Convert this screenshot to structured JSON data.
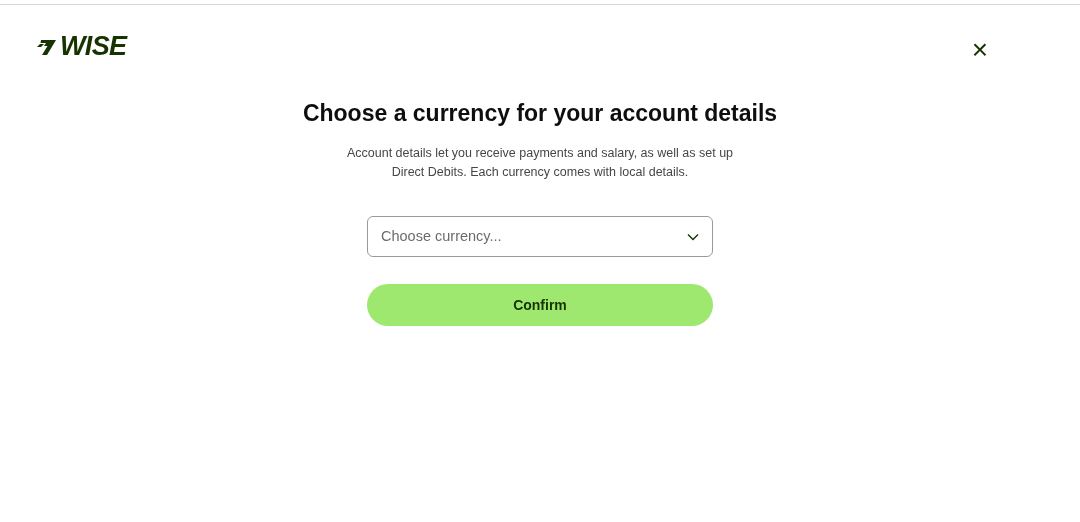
{
  "header": {
    "logo": "WISE",
    "close": "×"
  },
  "title": "Choose a currency for your account details",
  "description": "Account details let you receive payments and salary, as well as set up Direct Debits. Each currency comes with local details.",
  "currency_select": {
    "placeholder": "Choose currency..."
  },
  "confirm_button": "Confirm"
}
